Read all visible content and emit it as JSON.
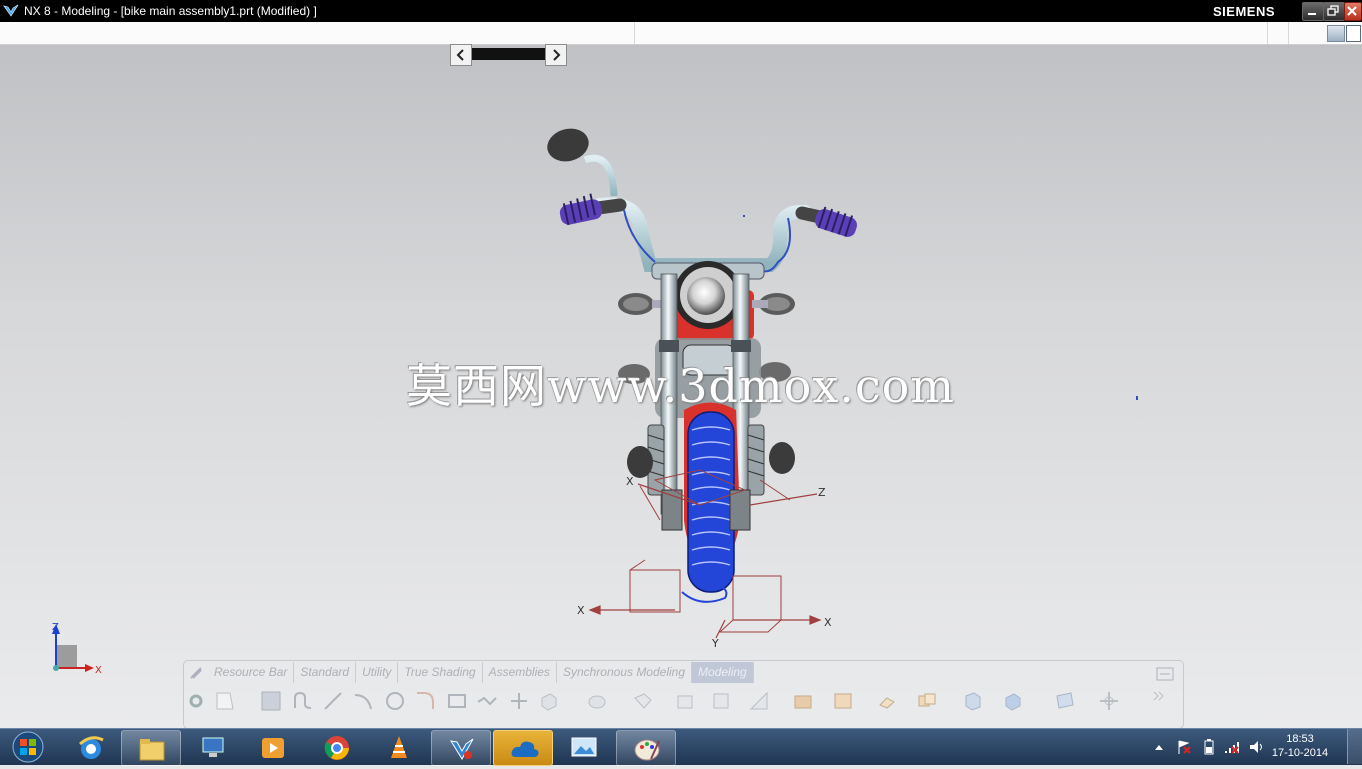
{
  "window": {
    "title": "NX 8 - Modeling - [bike main assembly1.prt (Modified) ]",
    "brand": "SIEMENS"
  },
  "watermark": "莫西网www.3dmox.com",
  "axes_labels": {
    "x": "X",
    "y": "Y",
    "z": "Z"
  },
  "resource_bar": {
    "tabs": [
      "Resource Bar",
      "Standard",
      "Utility",
      "True Shading",
      "Assemblies",
      "Synchronous Modeling",
      "Modeling"
    ],
    "active_tab": "Modeling"
  },
  "taskbar": {
    "apps": [
      "internet-explorer",
      "windows-explorer",
      "computer-management",
      "media-player",
      "google-chrome",
      "vlc-player",
      "siemens-nx",
      "onedrive",
      "photo-viewer",
      "paint"
    ],
    "time": "18:53",
    "date": "17-10-2014"
  },
  "colors": {
    "titlebar": "#000000",
    "viewport_top": "#bfc1c4",
    "viewport_bottom": "#eaebec",
    "taskbar": "#2a4466",
    "tire": "#2446d8",
    "fender": "#d9312b"
  }
}
